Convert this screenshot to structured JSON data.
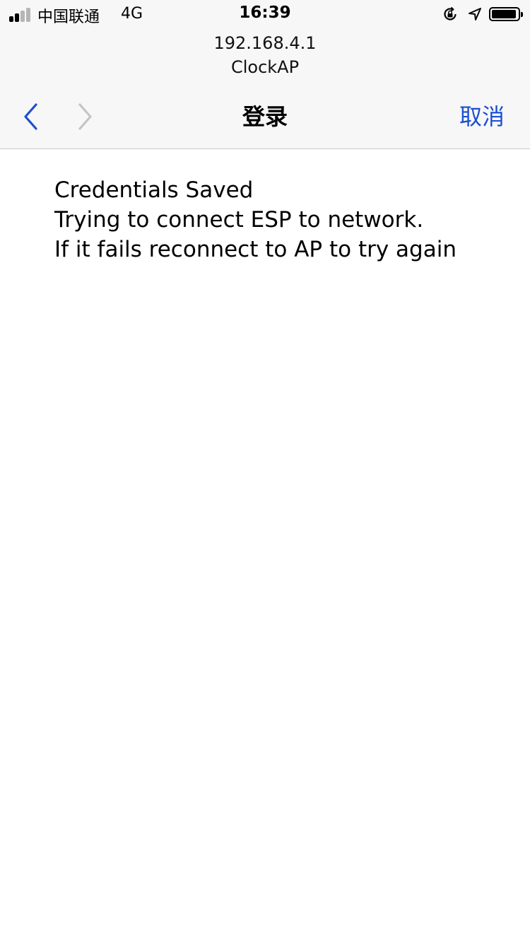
{
  "status_bar": {
    "carrier": "中国联通",
    "network": "4G",
    "time": "16:39",
    "signal_bars_filled": 2,
    "signal_bars_total": 4,
    "battery_level": 0.95,
    "icons": [
      "rotation-lock-icon",
      "location-icon",
      "battery-icon"
    ]
  },
  "browser": {
    "host": "192.168.4.1",
    "ssid": "ClockAP"
  },
  "nav": {
    "title": "登录",
    "cancel_label": "取消",
    "back_icon": "chevron-left-icon",
    "forward_icon": "chevron-right-icon"
  },
  "content": {
    "lines": [
      "Credentials Saved",
      "Trying to connect ESP to network.",
      "If it fails reconnect to AP to try again"
    ]
  },
  "colors": {
    "accent": "#1b4fd1",
    "chrome_bg": "#f7f7f7",
    "disabled": "#c4c4c4"
  }
}
